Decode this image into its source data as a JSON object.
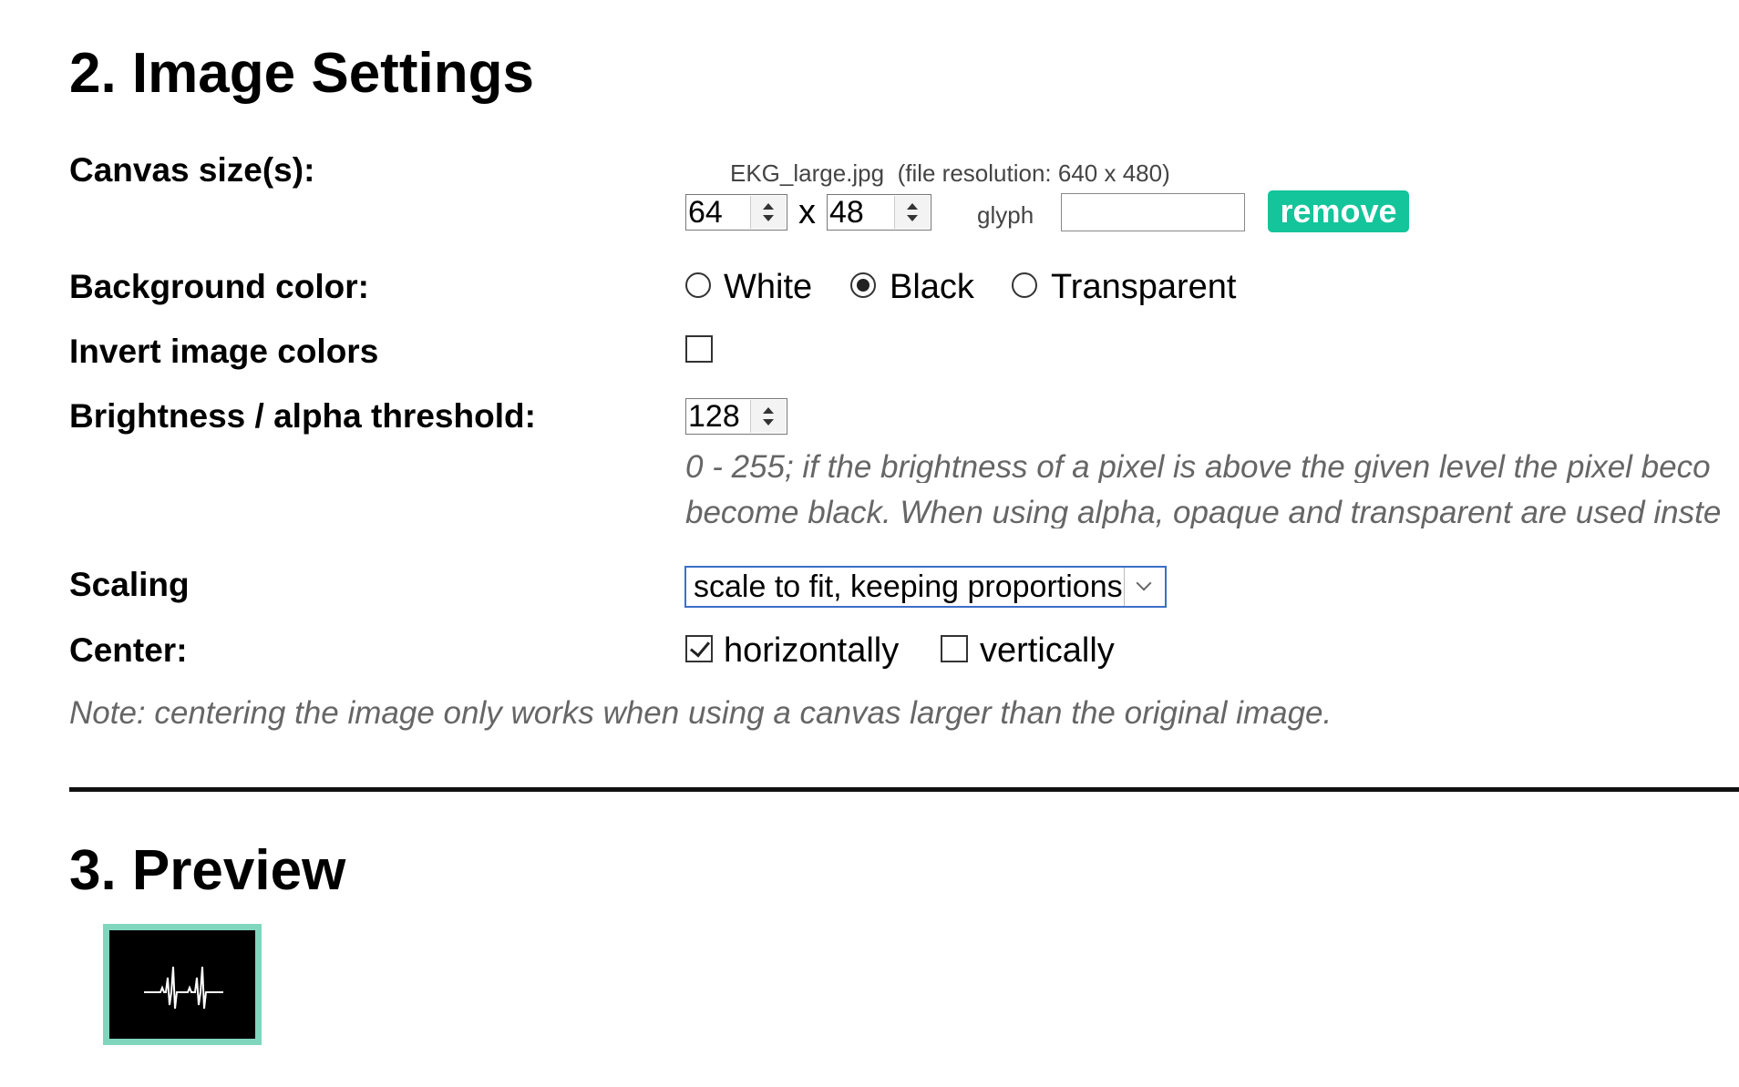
{
  "section2": {
    "title": "2. Image Settings",
    "canvas": {
      "label": "Canvas size(s):",
      "filename": "EKG_large.jpg",
      "resolution": "(file resolution: 640 x 480)",
      "width": "64",
      "separator": "x",
      "height": "48",
      "glyph_label": "glyph",
      "glyph_value": "",
      "remove_label": "remove"
    },
    "background": {
      "label": "Background color:",
      "options": [
        "White",
        "Black",
        "Transparent"
      ],
      "selected": "Black"
    },
    "invert": {
      "label": "Invert image colors",
      "checked": false
    },
    "threshold": {
      "label": "Brightness / alpha threshold:",
      "value": "128",
      "hint_line1": "0 - 255; if the brightness of a pixel is above the given level the pixel beco",
      "hint_line2": "become black. When using alpha, opaque and transparent are used inste"
    },
    "scaling": {
      "label": "Scaling",
      "value": "scale to fit, keeping proportions"
    },
    "center": {
      "label": "Center:",
      "horizontally_label": "horizontally",
      "horizontally_checked": true,
      "vertically_label": "vertically",
      "vertically_checked": false,
      "note": "Note: centering the image only works when using a canvas larger than the original image."
    }
  },
  "section3": {
    "title": "3. Preview",
    "preview_border_color": "#7fd6bd",
    "preview_bg_color": "#000000"
  },
  "colors": {
    "accent": "#14c49a",
    "select_border": "#3b6fc7",
    "hint": "#666666"
  }
}
